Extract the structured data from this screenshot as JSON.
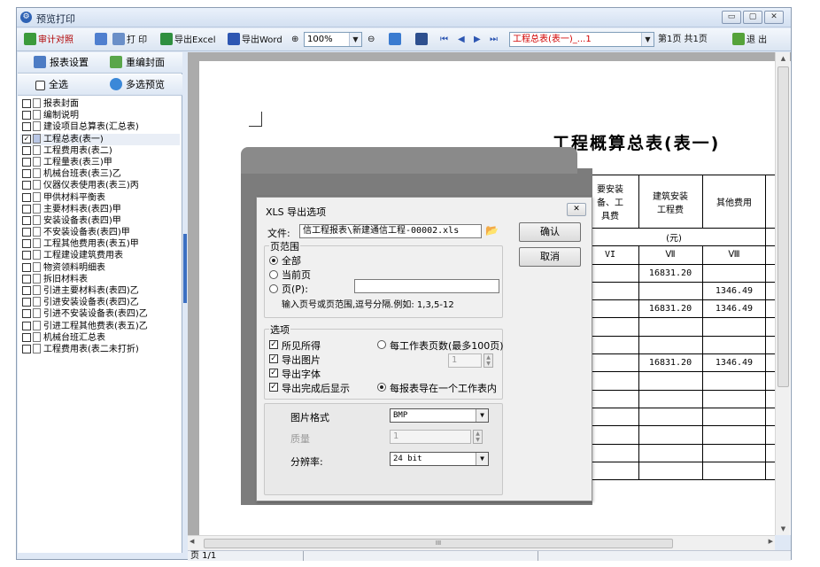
{
  "window": {
    "title": "预览打印",
    "buttons": [
      "▭",
      "▢",
      "✕"
    ]
  },
  "toolbar": {
    "audit_label": "审计对照",
    "print_label": "打 印",
    "export_excel_label": "导出Excel",
    "export_word_label": "导出Word",
    "zoom_value": "100%",
    "report_select": "工程总表(表一)_...1",
    "page_info": "第1页 共1页",
    "exit_label": "退 出"
  },
  "sidebar": {
    "report_settings": "报表设置",
    "rebuild_cover": "重编封面",
    "select_all": "全选",
    "multi_preview": "多选预览",
    "items": [
      {
        "label": "报表封面",
        "checked": false
      },
      {
        "label": "编制说明",
        "checked": false
      },
      {
        "label": "建设项目总算表(汇总表)",
        "checked": false
      },
      {
        "label": "工程总表(表一)",
        "checked": true
      },
      {
        "label": "工程费用表(表二)",
        "checked": false
      },
      {
        "label": "工程量表(表三)甲",
        "checked": false
      },
      {
        "label": "机械台班表(表三)乙",
        "checked": false
      },
      {
        "label": "仪器仪表使用表(表三)丙",
        "checked": false
      },
      {
        "label": "甲供材料平衡表",
        "checked": false
      },
      {
        "label": "主要材料表(表四)甲",
        "checked": false
      },
      {
        "label": "安装设备表(表四)甲",
        "checked": false
      },
      {
        "label": "不安装设备表(表四)甲",
        "checked": false
      },
      {
        "label": "工程其他费用表(表五)甲",
        "checked": false
      },
      {
        "label": "工程建设建筑费用表",
        "checked": false
      },
      {
        "label": "物资领料明细表",
        "checked": false
      },
      {
        "label": "拆旧材料表",
        "checked": false
      },
      {
        "label": "引进主要材料表(表四)乙",
        "checked": false
      },
      {
        "label": "引进安装设备表(表四)乙",
        "checked": false
      },
      {
        "label": "引进不安装设备表(表四)乙",
        "checked": false
      },
      {
        "label": "引进工程其他费表(表五)乙",
        "checked": false
      },
      {
        "label": "机械台班汇总表",
        "checked": false
      },
      {
        "label": "工程费用表(表二未打折)",
        "checked": false
      }
    ]
  },
  "report": {
    "title": "工程概算总表(表一)",
    "header_partial": "要安装\n备、工\n具费",
    "header_building": "建筑安装\n工程费",
    "header_other": "其他费用",
    "unit": "(元)",
    "col_vi": "VI",
    "col_vii": "Ⅶ",
    "col_viii": "Ⅷ",
    "rows": [
      {
        "vii": "16831.20",
        "viii": ""
      },
      {
        "vii": "",
        "viii": "1346.49"
      },
      {
        "vii": "16831.20",
        "viii": "1346.49"
      },
      {
        "vii": "",
        "viii": ""
      },
      {
        "vii": "",
        "viii": ""
      },
      {
        "vii": "16831.20",
        "viii": "1346.49"
      }
    ]
  },
  "dialog": {
    "title": "XLS 导出选项",
    "file_label": "文件:",
    "file_value": "信工程报表\\新建通信工程-00002.xls",
    "confirm": "确认",
    "cancel": "取消",
    "range_group": "页范围",
    "range_all": "全部",
    "range_current": "当前页",
    "range_pages": "页(P):",
    "range_hint": "输入页号或页范围,逗号分隔.例如: 1,3,5-12",
    "options_group": "选项",
    "opt_wysiwyg": "所见所得",
    "opt_export_images": "导出图片",
    "opt_export_fonts": "导出字体",
    "opt_show_after": "导出完成后显示",
    "opt_pages_per_sheet": "每工作表页数(最多100页)",
    "opt_pages_value": "1",
    "opt_one_sheet": "每报表导在一个工作表内",
    "image_format_label": "图片格式",
    "image_format_value": "BMP",
    "quality_label": "质量",
    "quality_value": "1",
    "resolution_label": "分辨率:",
    "resolution_value": "24 bit"
  },
  "status": {
    "page": "页 1/1"
  }
}
